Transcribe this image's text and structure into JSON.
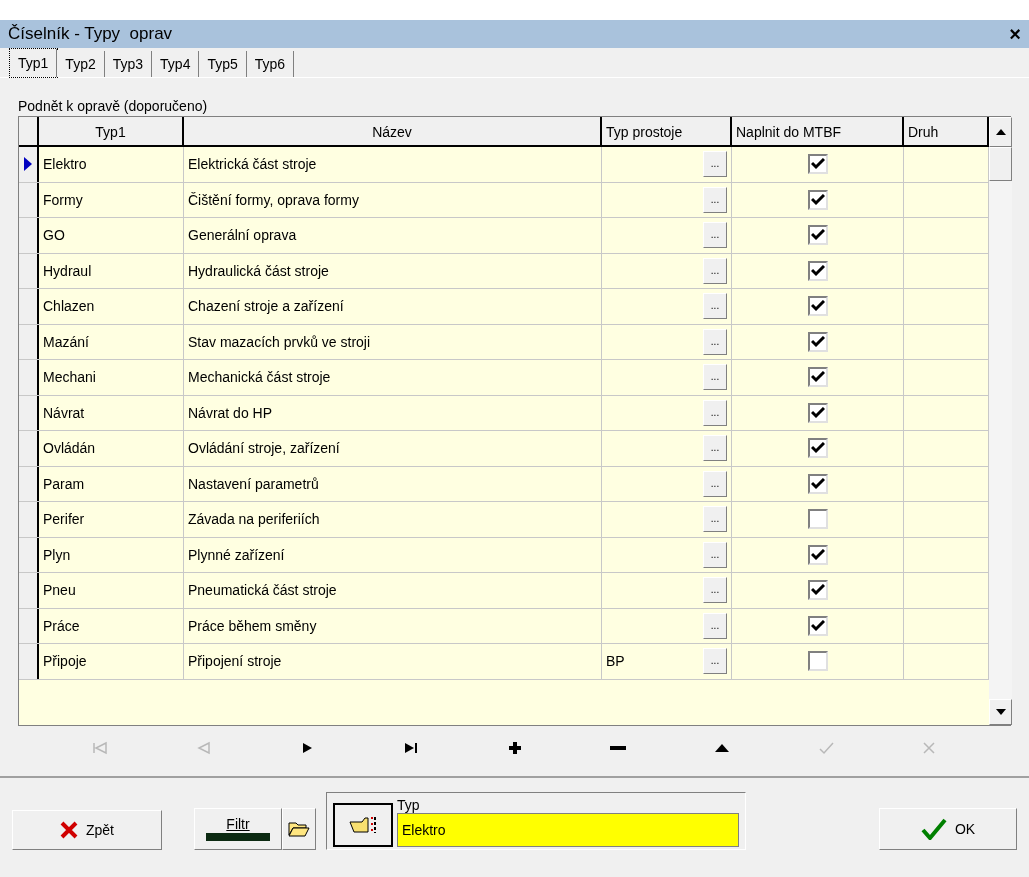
{
  "window": {
    "title": "Číselník - Typy  oprav",
    "close": "×"
  },
  "tabs": [
    {
      "label": "Typ1",
      "selected": true
    },
    {
      "label": "Typ2",
      "selected": false
    },
    {
      "label": "Typ3",
      "selected": false
    },
    {
      "label": "Typ4",
      "selected": false
    },
    {
      "label": "Typ5",
      "selected": false
    },
    {
      "label": "Typ6",
      "selected": false
    }
  ],
  "section_label": "Podnět k opravě (doporučeno)",
  "table": {
    "columns": [
      "Typ1",
      "Název",
      "Typ prostoje",
      "Naplnit do MTBF",
      "Druh"
    ],
    "rows": [
      {
        "code": "Elektro",
        "name": "Elektrická část stroje",
        "downtime": "",
        "mtbf": true,
        "selected": true
      },
      {
        "code": "Formy",
        "name": "Čištění formy, oprava formy",
        "downtime": "",
        "mtbf": true,
        "selected": false
      },
      {
        "code": "GO",
        "name": "Generální oprava",
        "downtime": "",
        "mtbf": true,
        "selected": false
      },
      {
        "code": "Hydraul",
        "name": "Hydraulická část stroje",
        "downtime": "",
        "mtbf": true,
        "selected": false
      },
      {
        "code": "Chlazen",
        "name": "Chazení stroje a zařízení",
        "downtime": "",
        "mtbf": true,
        "selected": false
      },
      {
        "code": "Mazání",
        "name": "Stav mazacích prvků ve stroji",
        "downtime": "",
        "mtbf": true,
        "selected": false
      },
      {
        "code": "Mechani",
        "name": "Mechanická část stroje",
        "downtime": "",
        "mtbf": true,
        "selected": false
      },
      {
        "code": "Návrat",
        "name": "Návrat do HP",
        "downtime": "",
        "mtbf": true,
        "selected": false
      },
      {
        "code": "Ovládán",
        "name": "Ovládání stroje, zařízení",
        "downtime": "",
        "mtbf": true,
        "selected": false
      },
      {
        "code": "Param",
        "name": "Nastavení parametrů",
        "downtime": "",
        "mtbf": true,
        "selected": false
      },
      {
        "code": "Perifer",
        "name": "Závada na periferiích",
        "downtime": "",
        "mtbf": false,
        "selected": false
      },
      {
        "code": "Plyn",
        "name": "Plynné zařízení",
        "downtime": "",
        "mtbf": true,
        "selected": false
      },
      {
        "code": "Pneu",
        "name": "Pneumatická část stroje",
        "downtime": "",
        "mtbf": true,
        "selected": false
      },
      {
        "code": "Práce",
        "name": "Práce během směny",
        "downtime": "",
        "mtbf": true,
        "selected": false
      },
      {
        "code": "Připoje",
        "name": "Připojení stroje",
        "downtime": "BP",
        "mtbf": false,
        "selected": false
      }
    ],
    "ellipsis": "..."
  },
  "navigator": [
    {
      "kind": "first",
      "disabled": true
    },
    {
      "kind": "prior",
      "disabled": true
    },
    {
      "kind": "next",
      "disabled": false
    },
    {
      "kind": "last",
      "disabled": false
    },
    {
      "kind": "insert",
      "disabled": false
    },
    {
      "kind": "delete",
      "disabled": false
    },
    {
      "kind": "edit",
      "disabled": false
    },
    {
      "kind": "post",
      "disabled": true
    },
    {
      "kind": "cancel",
      "disabled": true
    }
  ],
  "buttons": {
    "back": "Zpět",
    "filter": "Filtr",
    "ok": "OK"
  },
  "type_field": {
    "label": "Typ",
    "value": "Elektro"
  }
}
